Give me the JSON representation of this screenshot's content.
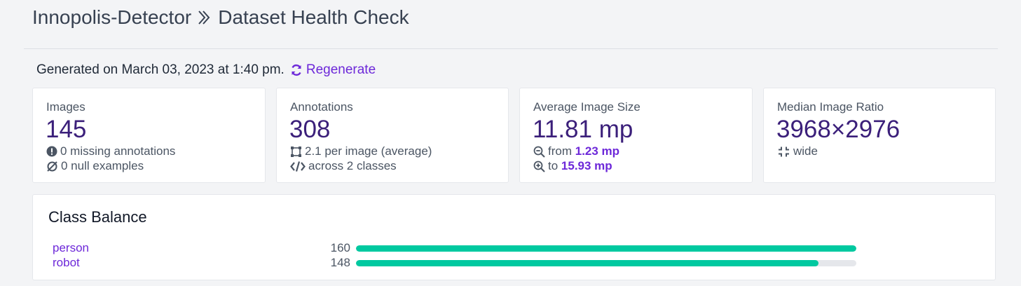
{
  "header": {
    "project": "Innopolis-Detector",
    "page": "Dataset Health Check"
  },
  "generated": {
    "text": "Generated on March 03, 2023 at 1:40 pm.",
    "regenerate_label": "Regenerate"
  },
  "cards": {
    "images": {
      "label": "Images",
      "value": "145",
      "missing": "0 missing annotations",
      "null_examples": "0 null examples"
    },
    "annotations": {
      "label": "Annotations",
      "value": "308",
      "per_image": "2.1 per image (average)",
      "classes": "across 2 classes"
    },
    "avg_size": {
      "label": "Average Image Size",
      "value": "11.81 mp",
      "from_prefix": "from",
      "from_value": "1.23 mp",
      "to_prefix": "to",
      "to_value": "15.93 mp"
    },
    "ratio": {
      "label": "Median Image Ratio",
      "value": "3968×2976",
      "shape": "wide"
    }
  },
  "class_balance": {
    "title": "Class Balance",
    "max": 160,
    "classes": [
      {
        "name": "person",
        "count": 160
      },
      {
        "name": "robot",
        "count": 148
      }
    ]
  },
  "colors": {
    "accent": "#6d28d9",
    "value_text": "#3b1f7a",
    "bar": "#00c9a0",
    "bar_track": "#e5e7eb"
  }
}
